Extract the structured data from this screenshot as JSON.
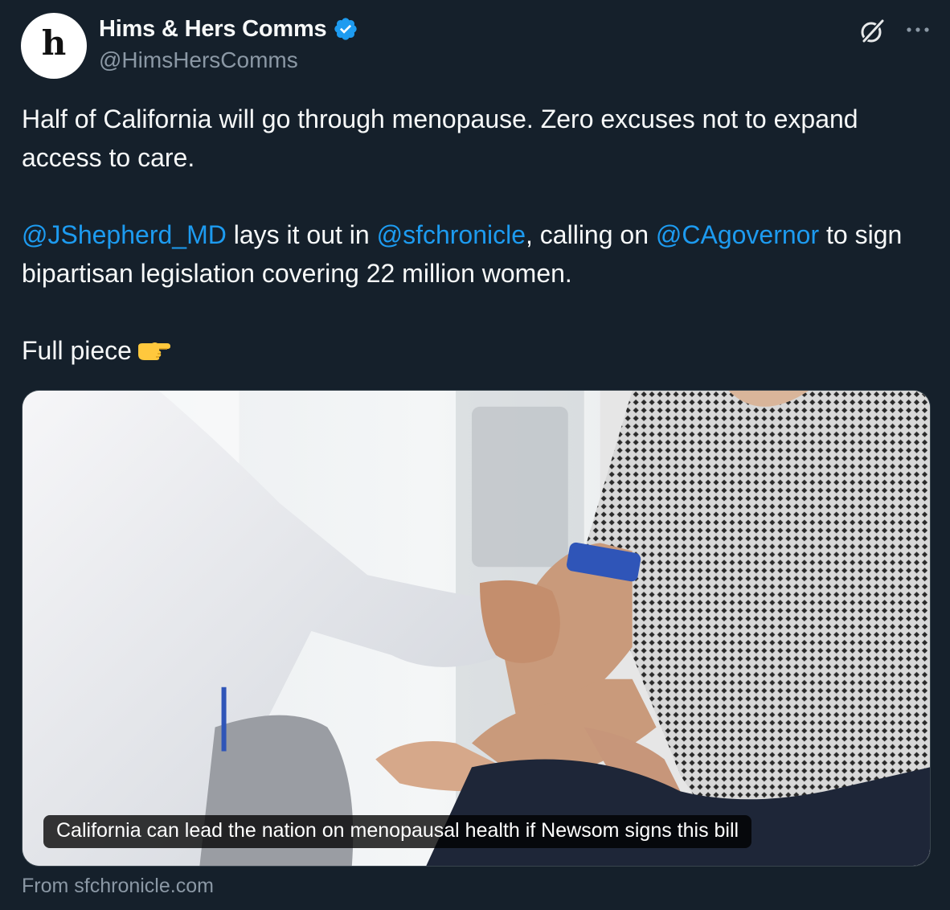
{
  "author": {
    "avatar_letter": "h",
    "display_name": "Hims & Hers Comms",
    "handle": "@HimsHersComms",
    "verified": true
  },
  "tweet": {
    "line1": "Half of California will go through menopause. Zero excuses not to expand access to care.",
    "mention1": "@JShepherd_MD",
    "text_a": " lays it out in ",
    "mention2": "@sfchronicle",
    "text_b": ", calling on ",
    "mention3": "@CAgovernor",
    "text_c": " to sign bipartisan legislation covering 22 million women.",
    "line3": "Full piece"
  },
  "card": {
    "headline": "California can lead the nation on menopausal health if Newsom signs this bill",
    "source": "From sfchronicle.com"
  },
  "icons": {
    "verified": "verified-badge-icon",
    "grok": "grok-icon",
    "more": "more-options-icon",
    "emoji": "pointing-right-emoji"
  },
  "colors": {
    "background": "#15202b",
    "link": "#1d9bf0",
    "secondary_text": "#8b98a5",
    "verified": "#1d9bf0"
  }
}
